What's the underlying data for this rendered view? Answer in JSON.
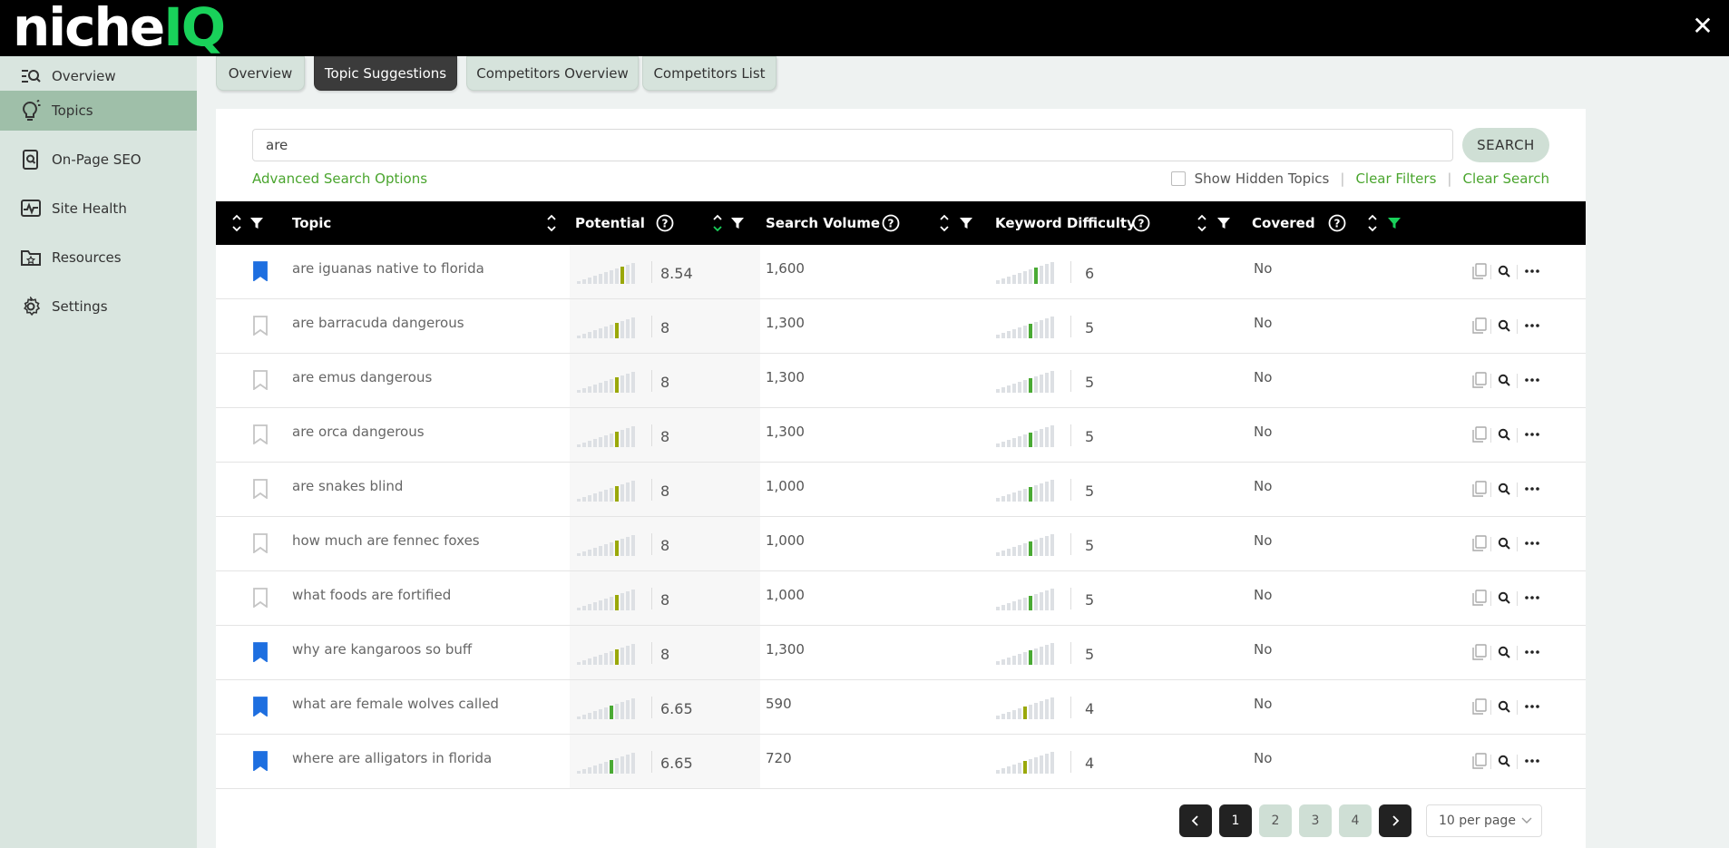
{
  "app": {
    "logo_part1": "niche",
    "logo_part2": "IQ",
    "close_glyph": "✕"
  },
  "sidebar": {
    "items": [
      {
        "label": "Overview",
        "icon": "overview-icon"
      },
      {
        "label": "Topics",
        "icon": "lightbulb-icon",
        "active": true
      },
      {
        "label": "On-Page SEO",
        "icon": "document-search-icon"
      },
      {
        "label": "Site Health",
        "icon": "heartbeat-icon"
      },
      {
        "label": "Resources",
        "icon": "folder-star-icon"
      },
      {
        "label": "Settings",
        "icon": "gear-icon"
      }
    ]
  },
  "tabs": [
    {
      "label": "Overview"
    },
    {
      "label": "Topic Suggestions",
      "active": true
    },
    {
      "label": "Competitors Overview"
    },
    {
      "label": "Competitors List"
    }
  ],
  "search": {
    "value": "are",
    "button_label": "SEARCH",
    "advanced_label": "Advanced Search Options",
    "show_hidden_label": "Show Hidden Topics",
    "clear_filters_label": "Clear Filters",
    "clear_search_label": "Clear Search",
    "separator": "|"
  },
  "table": {
    "headers": {
      "topic": "Topic",
      "potential": "Potential",
      "search_volume": "Search Volume",
      "keyword_difficulty": "Keyword Difficulty",
      "covered": "Covered"
    },
    "rows": [
      {
        "bookmarked": true,
        "topic": "are iguanas native to florida",
        "potential": "8.54",
        "volume": "1,600",
        "difficulty": "6",
        "covered": "No"
      },
      {
        "bookmarked": false,
        "topic": "are barracuda dangerous",
        "potential": "8",
        "volume": "1,300",
        "difficulty": "5",
        "covered": "No"
      },
      {
        "bookmarked": false,
        "topic": "are emus dangerous",
        "potential": "8",
        "volume": "1,300",
        "difficulty": "5",
        "covered": "No"
      },
      {
        "bookmarked": false,
        "topic": "are orca dangerous",
        "potential": "8",
        "volume": "1,300",
        "difficulty": "5",
        "covered": "No"
      },
      {
        "bookmarked": false,
        "topic": "are snakes blind",
        "potential": "8",
        "volume": "1,000",
        "difficulty": "5",
        "covered": "No"
      },
      {
        "bookmarked": false,
        "topic": "how much are fennec foxes",
        "potential": "8",
        "volume": "1,000",
        "difficulty": "5",
        "covered": "No"
      },
      {
        "bookmarked": false,
        "topic": "what foods are fortified",
        "potential": "8",
        "volume": "1,000",
        "difficulty": "5",
        "covered": "No"
      },
      {
        "bookmarked": true,
        "topic": "why are kangaroos so buff",
        "potential": "8",
        "volume": "1,300",
        "difficulty": "5",
        "covered": "No"
      },
      {
        "bookmarked": true,
        "topic": "what are female wolves called",
        "potential": "6.65",
        "volume": "590",
        "difficulty": "4",
        "covered": "No"
      },
      {
        "bookmarked": true,
        "topic": "where are alligators in florida",
        "potential": "6.65",
        "volume": "720",
        "difficulty": "4",
        "covered": "No"
      }
    ]
  },
  "pagination": {
    "pages": [
      "1",
      "2",
      "3",
      "4"
    ],
    "current": "1",
    "per_page": "10 per page"
  },
  "colors": {
    "accent_green": "#4aa52e",
    "logo_green": "#19d15a",
    "bookmark_blue": "#1e6fe0",
    "bar_olive": "#9aa80a",
    "bar_green": "#4aaa34",
    "bar_gray": "#dde0e4"
  }
}
